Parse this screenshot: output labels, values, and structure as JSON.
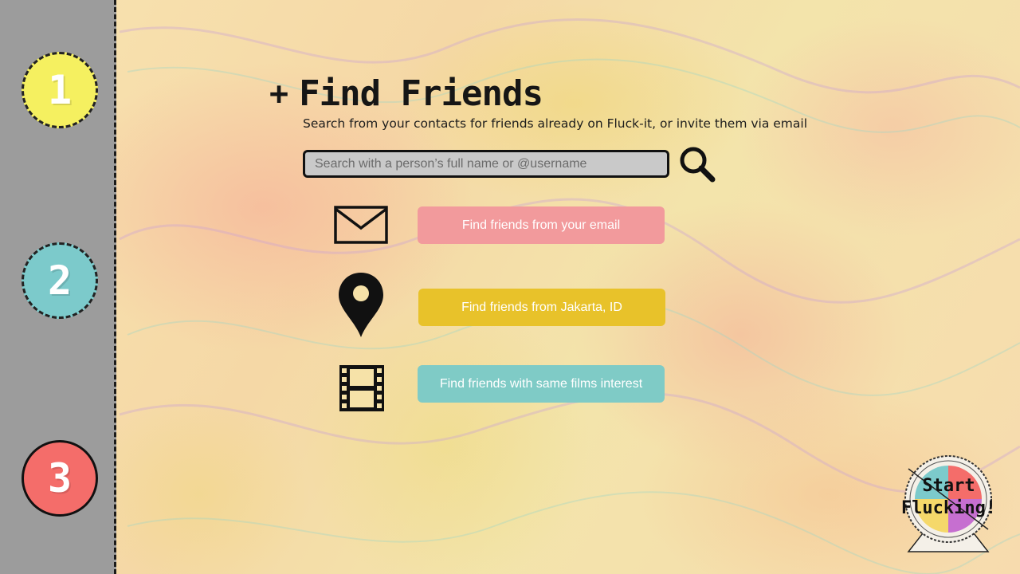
{
  "sidebar": {
    "steps": [
      {
        "label": "1",
        "color": "#f5f060"
      },
      {
        "label": "2",
        "color": "#7ccacb"
      },
      {
        "label": "3",
        "color": "#f46d6a"
      }
    ]
  },
  "header": {
    "plus": "+",
    "title": "Find Friends",
    "subtitle": "Search from your contacts for friends already on Fluck-it, or invite them via email"
  },
  "search": {
    "value": "",
    "placeholder": "Search with a person’s full name or @username",
    "icon": "magnifier-icon"
  },
  "options": [
    {
      "icon": "envelope-icon",
      "label": "Find friends from your email",
      "color": "#f29a9c"
    },
    {
      "icon": "map-pin-icon",
      "label": "Find friends from Jakarta, ID",
      "color": "#e8c22a"
    },
    {
      "icon": "film-strip-icon",
      "label": "Find friends with same films interest",
      "color": "#7fcbc6"
    }
  ],
  "start": {
    "line1": "Start",
    "line2": "Flucking!"
  }
}
